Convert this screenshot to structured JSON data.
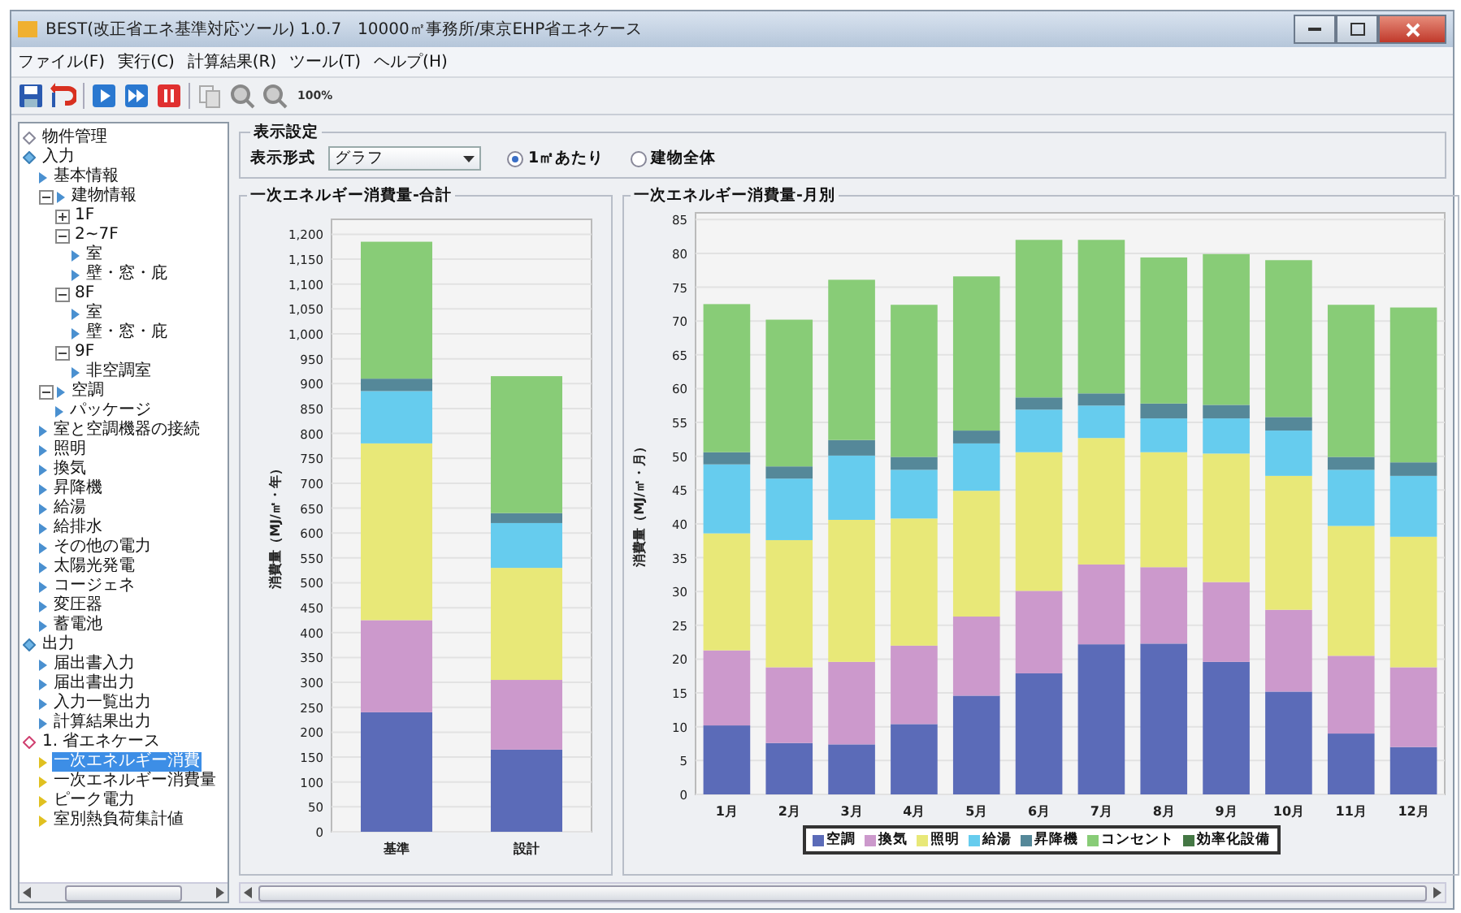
{
  "window": {
    "title": "BEST(改正省エネ基準対応ツール) 1.0.7　10000㎡事務所/東京EHP省エネケース"
  },
  "menu": [
    "ファイル(F)",
    "実行(C)",
    "計算結果(R)",
    "ツール(T)",
    "ヘルプ(H)"
  ],
  "toolbar": [
    {
      "kind": "save"
    },
    {
      "kind": "undo"
    },
    {
      "kind": "sep"
    },
    {
      "kind": "run"
    },
    {
      "kind": "run-all"
    },
    {
      "kind": "stop"
    },
    {
      "kind": "sep"
    },
    {
      "kind": "copy"
    },
    {
      "kind": "zoom-in"
    },
    {
      "kind": "zoom-out"
    },
    {
      "kind": "text",
      "label": "100%"
    }
  ],
  "tree": [
    {
      "label": "物件管理",
      "kind": "project",
      "selected": false
    },
    {
      "label": "入力",
      "kind": "section",
      "selected": false,
      "children": [
        {
          "label": "基本情報",
          "kind": "item",
          "selected": false
        },
        {
          "label": "建物情報",
          "kind": "item",
          "selected": false,
          "expanded": true,
          "children": [
            {
              "label": "1F",
              "kind": "floor",
              "selected": false,
              "expanded": false
            },
            {
              "label": "2~7F",
              "kind": "floor",
              "selected": false,
              "expanded": true,
              "children": [
                {
                  "label": "室",
                  "kind": "item",
                  "selected": false
                },
                {
                  "label": "壁・窓・庇",
                  "kind": "item",
                  "selected": false
                }
              ]
            },
            {
              "label": "8F",
              "kind": "floor",
              "selected": false,
              "expanded": true,
              "children": [
                {
                  "label": "室",
                  "kind": "item",
                  "selected": false
                },
                {
                  "label": "壁・窓・庇",
                  "kind": "item",
                  "selected": false
                }
              ]
            },
            {
              "label": "9F",
              "kind": "floor",
              "selected": false,
              "expanded": true,
              "children": [
                {
                  "label": "非空調室",
                  "kind": "item",
                  "selected": false
                }
              ]
            }
          ]
        },
        {
          "label": "空調",
          "kind": "item",
          "selected": false,
          "expanded": true,
          "children": [
            {
              "label": "パッケージ",
              "kind": "item",
              "selected": false
            }
          ]
        },
        {
          "label": "室と空調機器の接続",
          "kind": "item",
          "selected": false
        },
        {
          "label": "照明",
          "kind": "item",
          "selected": false
        },
        {
          "label": "換気",
          "kind": "item",
          "selected": false
        },
        {
          "label": "昇降機",
          "kind": "item",
          "selected": false
        },
        {
          "label": "給湯",
          "kind": "item",
          "selected": false
        },
        {
          "label": "給排水",
          "kind": "item",
          "selected": false
        },
        {
          "label": "その他の電力",
          "kind": "item",
          "selected": false
        },
        {
          "label": "太陽光発電",
          "kind": "item",
          "selected": false
        },
        {
          "label": "コージェネ",
          "kind": "item",
          "selected": false
        },
        {
          "label": "変圧器",
          "kind": "item",
          "selected": false
        },
        {
          "label": "蓄電池",
          "kind": "item",
          "selected": false
        }
      ]
    },
    {
      "label": "出力",
      "kind": "section",
      "selected": false,
      "children": [
        {
          "label": "届出書入力",
          "kind": "item",
          "selected": false
        },
        {
          "label": "届出書出力",
          "kind": "item",
          "selected": false
        },
        {
          "label": "入力一覧出力",
          "kind": "item",
          "selected": false
        },
        {
          "label": "計算結果出力",
          "kind": "item",
          "selected": false
        }
      ]
    },
    {
      "label": "1. 省エネケース",
      "kind": "case",
      "selected": false,
      "children": [
        {
          "label": "一次エネルギー消費",
          "kind": "result",
          "selected": true
        },
        {
          "label": "一次エネルギー消費量",
          "kind": "result",
          "selected": false
        },
        {
          "label": "ピーク電力",
          "kind": "result",
          "selected": false
        },
        {
          "label": "室別熱負荷集計値",
          "kind": "result",
          "selected": false
        }
      ]
    }
  ],
  "settings": {
    "title": "表示設定",
    "format_label": "表示形式",
    "format_value": "グラフ",
    "scope": [
      {
        "label": "1㎡あたり",
        "selected": true
      },
      {
        "label": "建物全体",
        "selected": false
      }
    ]
  },
  "total_panel": {
    "title": "一次エネルギー消費量-合計",
    "chart_data": {
      "type": "bar",
      "stacked": true,
      "grid": true,
      "ylabel": "消費量（MJ/㎡・年）",
      "categories": [
        "基準",
        "設計"
      ],
      "ylim": [
        0,
        1230
      ],
      "yticks": [
        0,
        50,
        100,
        150,
        200,
        250,
        300,
        350,
        400,
        450,
        500,
        550,
        600,
        650,
        700,
        750,
        800,
        850,
        900,
        950,
        {
          "value": 1000,
          "label": "1,000"
        },
        {
          "value": 1050,
          "label": "1,050"
        },
        {
          "value": 1100,
          "label": "1,100"
        },
        {
          "value": 1150,
          "label": "1,150"
        },
        {
          "value": 1200,
          "label": "1,200"
        }
      ],
      "series": [
        {
          "color": "#5b6bb8",
          "values": [
            240,
            165
          ]
        },
        {
          "color": "#cc99cc",
          "values": [
            185,
            140
          ]
        },
        {
          "color": "#e8e878",
          "values": [
            355,
            225
          ]
        },
        {
          "color": "#66ccee",
          "values": [
            105,
            90
          ]
        },
        {
          "color": "#558899",
          "values": [
            25,
            20
          ]
        },
        {
          "color": "#88cc77",
          "values": [
            275,
            275
          ]
        }
      ]
    }
  },
  "monthly_panel": {
    "title": "一次エネルギー消費量-月別",
    "chart_data": {
      "type": "bar",
      "stacked": true,
      "grid": true,
      "ylabel": "消費量（MJ/㎡・月）",
      "categories": [
        "1月",
        "2月",
        "3月",
        "4月",
        "5月",
        "6月",
        "7月",
        "8月",
        "9月",
        "10月",
        "11月",
        "12月"
      ],
      "ylim": [
        0,
        86
      ],
      "yticks": [
        0,
        5,
        10,
        15,
        20,
        25,
        30,
        35,
        40,
        45,
        50,
        55,
        60,
        65,
        70,
        75,
        80,
        85
      ],
      "series": [
        {
          "name": "空調",
          "color": "#5b6bb8",
          "values": [
            10.2,
            7.6,
            7.4,
            10.4,
            14.6,
            17.9,
            22.2,
            22.3,
            19.6,
            15.2,
            9.0,
            7.0
          ]
        },
        {
          "name": "換気",
          "color": "#cc99cc",
          "values": [
            11.1,
            11.2,
            12.2,
            11.6,
            11.7,
            12.2,
            11.8,
            11.3,
            11.8,
            12.1,
            11.5,
            11.8
          ]
        },
        {
          "name": "照明",
          "color": "#e8e878",
          "values": [
            17.3,
            18.8,
            21.0,
            18.8,
            18.6,
            20.5,
            18.7,
            17.0,
            19.0,
            19.8,
            19.2,
            19.3
          ]
        },
        {
          "name": "給湯",
          "color": "#66ccee",
          "values": [
            10.2,
            9.1,
            9.5,
            7.2,
            7.0,
            6.3,
            4.8,
            5.0,
            5.2,
            6.7,
            8.3,
            9.0
          ]
        },
        {
          "name": "昇降機",
          "color": "#558899",
          "values": [
            1.8,
            1.8,
            2.3,
            1.9,
            1.9,
            1.8,
            1.8,
            2.2,
            2.0,
            2.0,
            1.9,
            2.0
          ]
        },
        {
          "name": "コンセント",
          "color": "#88cc77",
          "values": [
            21.9,
            21.7,
            23.7,
            22.5,
            22.8,
            23.3,
            22.7,
            21.6,
            22.3,
            23.2,
            22.5,
            22.9
          ]
        },
        {
          "name": "効率化設備",
          "color": "#447744",
          "values": [
            0,
            0,
            0,
            0,
            0,
            0,
            0,
            0,
            0,
            0,
            0,
            0
          ]
        }
      ]
    }
  }
}
